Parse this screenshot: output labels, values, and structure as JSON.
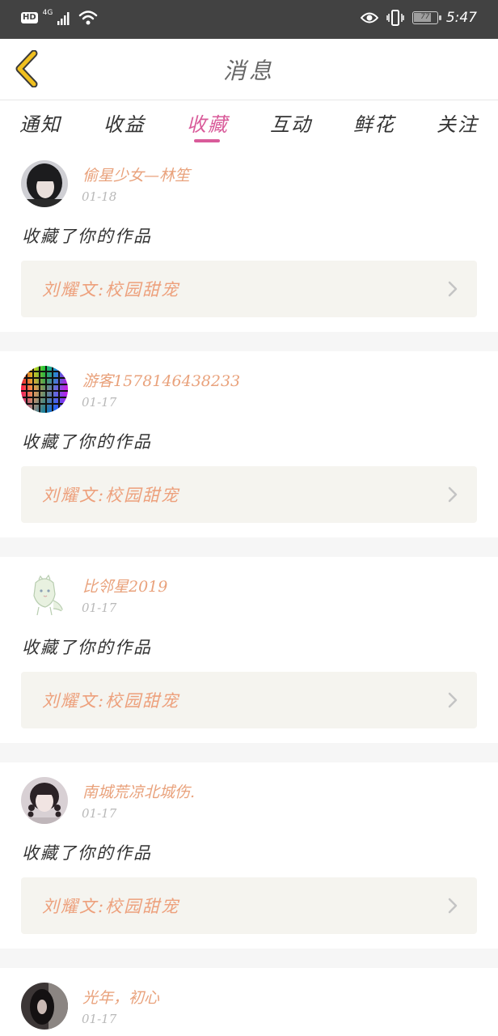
{
  "status_bar": {
    "hd_label": "HD",
    "network_label": "4G",
    "battery_level": "77",
    "battery_fraction": 0.77,
    "time": "5:47",
    "icons": [
      "signal-icon",
      "wifi-icon",
      "eye-icon",
      "vibrate-icon",
      "battery-icon"
    ]
  },
  "header": {
    "title": "消息",
    "back_icon": "back-chevron-icon",
    "accent_color": "#f0c020"
  },
  "tabs": [
    {
      "label": "通知"
    },
    {
      "label": "收益"
    },
    {
      "label": "收藏"
    },
    {
      "label": "互动"
    },
    {
      "label": "鲜花"
    },
    {
      "label": "关注"
    }
  ],
  "active_tab": "收藏",
  "colors": {
    "accent_pink": "#d95b9a",
    "username_orange": "#e9a27c",
    "work_title_orange": "#eda07c",
    "card_bg": "#f5f4ef"
  },
  "feed": [
    {
      "username": "偷星少女—林笙",
      "date": "01-18",
      "action": "收藏了你的作品",
      "work_title": "刘耀文:校园甜宠",
      "avatar": "dark-hair-avatar"
    },
    {
      "username": "游客1578146438233",
      "date": "01-17",
      "action": "收藏了你的作品",
      "work_title": "刘耀文:校园甜宠",
      "avatar": "color-grid-avatar"
    },
    {
      "username": "比邻星2019",
      "date": "01-17",
      "action": "收藏了你的作品",
      "work_title": "刘耀文:校园甜宠",
      "avatar": "dino-sketch-avatar"
    },
    {
      "username": "南城荒凉北城伤.",
      "date": "01-17",
      "action": "收藏了你的作品",
      "work_title": "刘耀文:校园甜宠",
      "avatar": "braids-girl-avatar"
    },
    {
      "username": "光年，初心",
      "date": "01-17",
      "avatar": "dark-portrait-avatar"
    }
  ]
}
